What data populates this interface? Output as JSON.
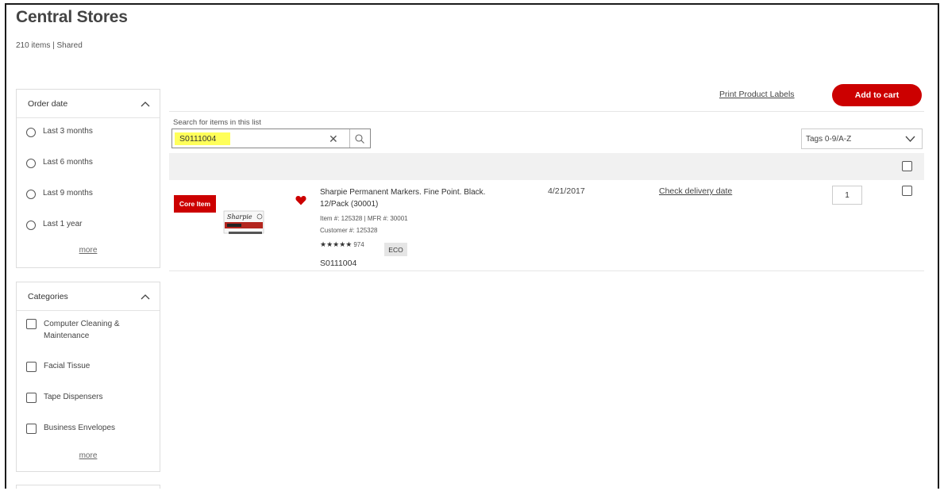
{
  "page": {
    "title": "Central Stores",
    "subtitle": "210 items | Shared"
  },
  "filters": {
    "order_date": {
      "title": "Order date",
      "options": [
        "Last 3 months",
        "Last 6 months",
        "Last 9 months",
        "Last 1 year"
      ],
      "more": "more"
    },
    "categories": {
      "title": "Categories",
      "options": [
        "Computer Cleaning & Maintenance",
        "Facial Tissue",
        "Tape Dispensers",
        "Business Envelopes"
      ],
      "more": "more"
    }
  },
  "toolbar": {
    "print_labels": "Print Product Labels",
    "add_to_cart": "Add to cart"
  },
  "search": {
    "label": "Search for items in this list",
    "value": "S0111004"
  },
  "sort": {
    "selected": "Tags 0-9/A-Z"
  },
  "items": [
    {
      "badge": "Core Item",
      "name": "Sharpie Permanent Markers. Fine Point. Black. 12/Pack (30001)",
      "item_line": "Item #: 125328 | MFR #: 30001",
      "customer_line": "Customer #: 125328",
      "stars": "★★★★★",
      "rating_count": "974",
      "eco": "ECO",
      "sku": "S0111004",
      "order_date": "4/21/2017",
      "delivery": "Check delivery date",
      "qty": "1"
    }
  ],
  "colors": {
    "brand_red": "#cc0000",
    "search_highlight": "#ffff5a"
  }
}
